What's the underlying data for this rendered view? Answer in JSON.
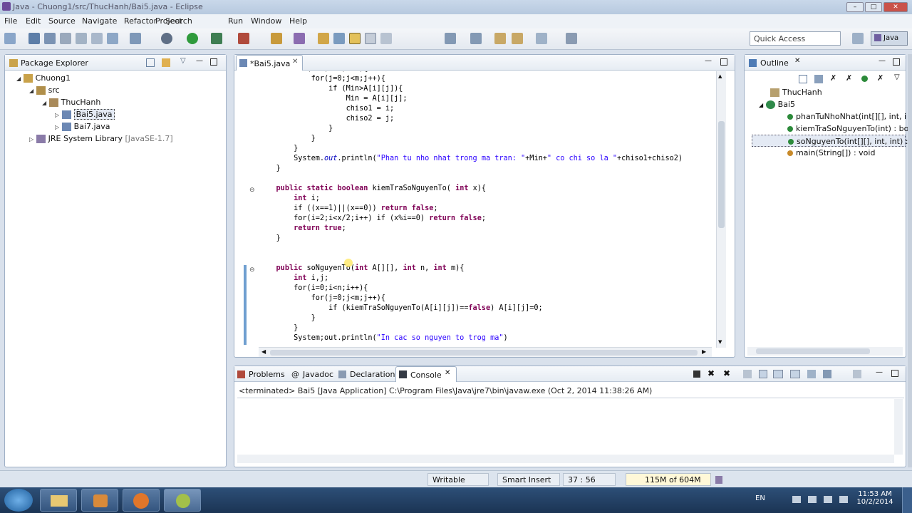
{
  "window": {
    "title": "Java - Chuong1/src/ThucHanh/Bai5.java - Eclipse"
  },
  "menu": [
    "File",
    "Edit",
    "Source",
    "Refactor",
    "Navigate",
    "Search",
    "Project",
    "Run",
    "Window",
    "Help"
  ],
  "quick_access": {
    "placeholder": "Quick Access"
  },
  "perspective": {
    "label": "Java"
  },
  "package_explorer": {
    "title": "Package Explorer",
    "items": [
      {
        "label": "Chuong1"
      },
      {
        "label": "src"
      },
      {
        "label": "ThucHanh"
      },
      {
        "label": "Bai5.java"
      },
      {
        "label": "Bai7.java"
      },
      {
        "label": "JRE System Library",
        "suffix": "[JavaSE-1.7]"
      }
    ]
  },
  "editor": {
    "tab_label": "*Bai5.java",
    "lines": [
      "            for(j=0;j<m;j++){",
      "                if (Min>A[i][j]){",
      "                    Min = A[i][j];",
      "                    chiso1 = i;",
      "                    chiso2 = j;",
      "                }",
      "            }",
      "        }",
      "        System.out.println(\"Phan tu nho nhat trong ma tran: \"+Min+\" co chi so la \"+chiso1+chiso2)",
      "    }",
      "",
      "    public static boolean kiemTraSoNguyenTo( int x){",
      "        int i;",
      "        if ((x==1)||(x==0)) return false;",
      "        for(i=2;i<x/2;i++) if (x%i==0) return false;",
      "        return true;",
      "    }",
      "",
      "",
      "    public soNguyenTo(int A[][], int n, int m){",
      "        int i,j;",
      "        for(i=0;i<n;i++){",
      "            for(j=0;j<m;j++){",
      "                if (kiemTraSoNguyenTo(A[i][j])==false) A[i][j]=0;",
      "            }",
      "        }",
      "        System;out.println(\"In cac so nguyen to trog ma\")"
    ]
  },
  "outline": {
    "title": "Outline",
    "items": [
      {
        "label": "ThucHanh"
      },
      {
        "label": "Bai5"
      },
      {
        "label": "phanTuNhoNhat(int[][], int, i"
      },
      {
        "label": "kiemTraSoNguyenTo(int) : bo"
      },
      {
        "label": "soNguyenTo(int[][], int, int) :"
      },
      {
        "label": "main(String[]) : void"
      }
    ]
  },
  "bottom_tabs": [
    {
      "label": "Problems"
    },
    {
      "label": "Javadoc"
    },
    {
      "label": "Declaration"
    },
    {
      "label": "Console"
    }
  ],
  "console": {
    "status": "<terminated> Bai5 [Java Application] C:\\Program Files\\Java\\jre7\\bin\\javaw.exe (Oct 2, 2014 11:38:26 AM)"
  },
  "status_bar": {
    "writable": "Writable",
    "insert_mode": "Smart Insert",
    "position": "37 : 56",
    "memory": "115M of 604M"
  },
  "taskbar": {
    "lang": "EN",
    "time": "11:53 AM",
    "date": "10/2/2014"
  }
}
